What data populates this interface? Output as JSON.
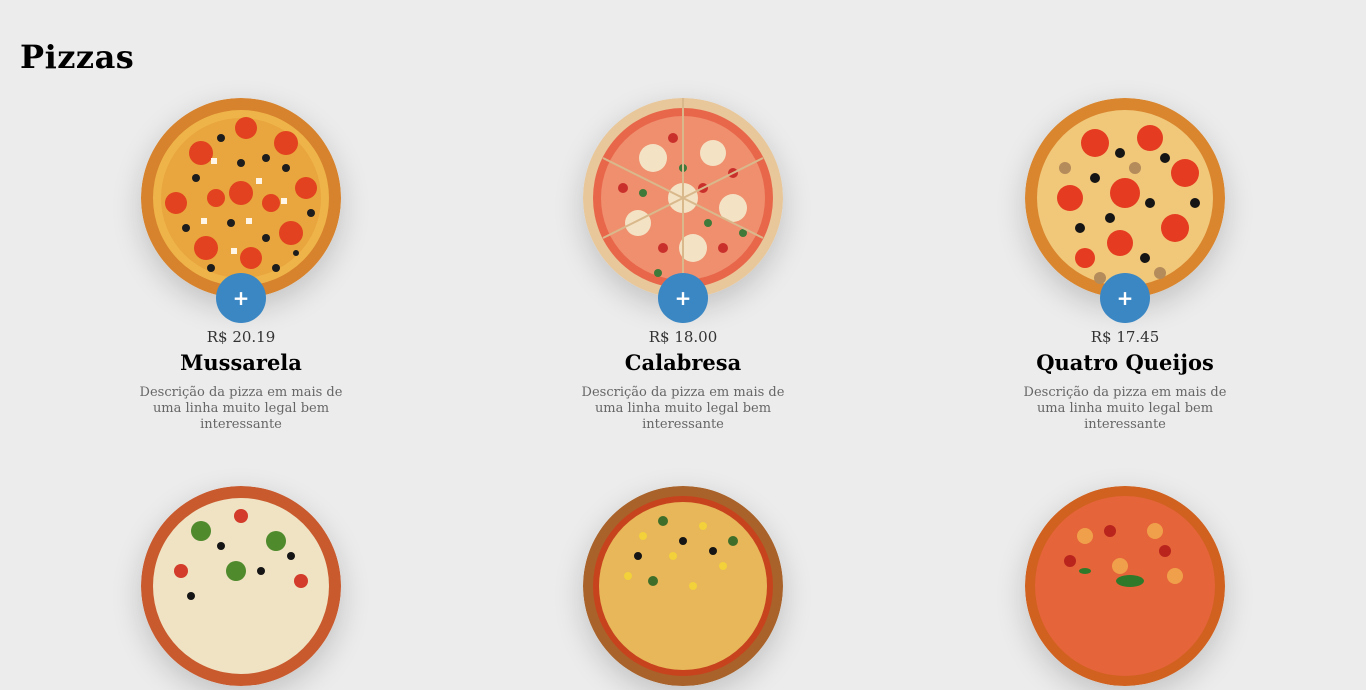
{
  "section": {
    "title": "Pizzas"
  },
  "accent": "#3a87c4",
  "pizzas": [
    {
      "price": "R$ 20.19",
      "name": "Mussarela",
      "description": "Descrição da pizza em mais de uma linha muito legal bem interessante",
      "add_label": "+"
    },
    {
      "price": "R$ 18.00",
      "name": "Calabresa",
      "description": "Descrição da pizza em mais de uma linha muito legal bem interessante",
      "add_label": "+"
    },
    {
      "price": "R$ 17.45",
      "name": "Quatro Queijos",
      "description": "Descrição da pizza em mais de uma linha muito legal bem interessante",
      "add_label": "+"
    }
  ]
}
